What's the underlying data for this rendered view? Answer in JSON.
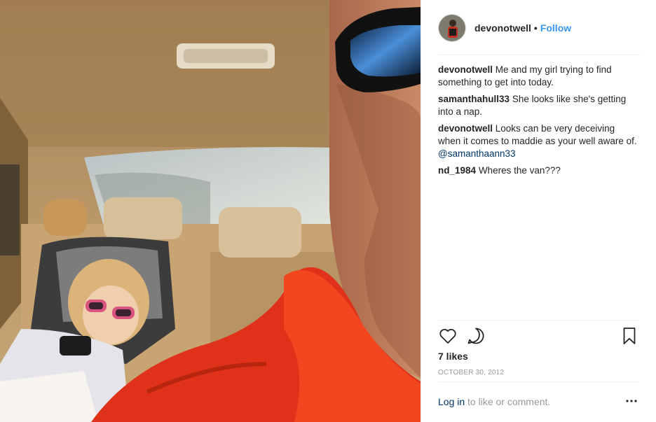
{
  "post": {
    "username": "devonotwell",
    "follow_label": "Follow",
    "separator": "•",
    "photo_alt": "",
    "comments": [
      {
        "user": "devonotwell",
        "text": "Me and my girl trying to find something to get into today.",
        "mention": ""
      },
      {
        "user": "samanthahull33",
        "text": "She looks like she's getting into a nap.",
        "mention": ""
      },
      {
        "user": "devonotwell",
        "text": "Looks can be very deceiving when it comes to maddie as your well aware of.",
        "mention": "@samanthaann33"
      },
      {
        "user": "nd_1984",
        "text": "Wheres the van???",
        "mention": ""
      }
    ],
    "likes": "7 likes",
    "date": "OCTOBER 30, 2012",
    "login_link": "Log in",
    "login_suffix": " to like or comment."
  },
  "icons": {
    "like": "heart-icon",
    "comment": "comment-bubble-icon",
    "save": "bookmark-icon",
    "more": "more-options-icon"
  },
  "colors": {
    "link_blue": "#3897f0",
    "mention_blue": "#003569",
    "text": "#262626",
    "muted": "#999999",
    "divider": "#efefef"
  }
}
